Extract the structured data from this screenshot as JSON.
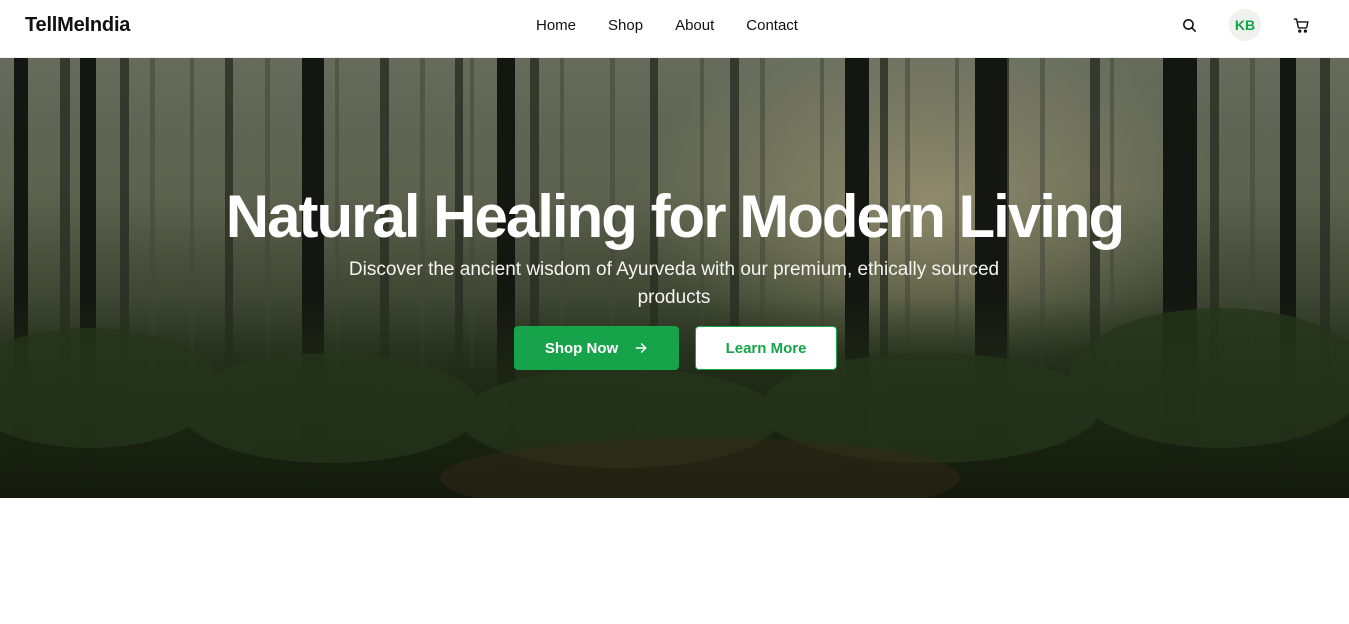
{
  "brand": {
    "name": "TellMeIndia"
  },
  "nav": {
    "links": [
      {
        "label": "Home"
      },
      {
        "label": "Shop"
      },
      {
        "label": "About"
      },
      {
        "label": "Contact"
      }
    ]
  },
  "header_actions": {
    "search_icon": "search-icon",
    "avatar_initials": "KB",
    "cart_icon": "cart-icon"
  },
  "hero": {
    "title": "Natural Healing for Modern Living",
    "subtitle": "Discover the ancient wisdom of Ayurveda with our premium, ethically sourced products",
    "primary_button": "Shop Now",
    "secondary_button": "Learn More",
    "background_image": "forest-photo"
  },
  "colors": {
    "accent": "#16a34a",
    "avatar_bg": "#eef1ee",
    "text": "#111111"
  }
}
